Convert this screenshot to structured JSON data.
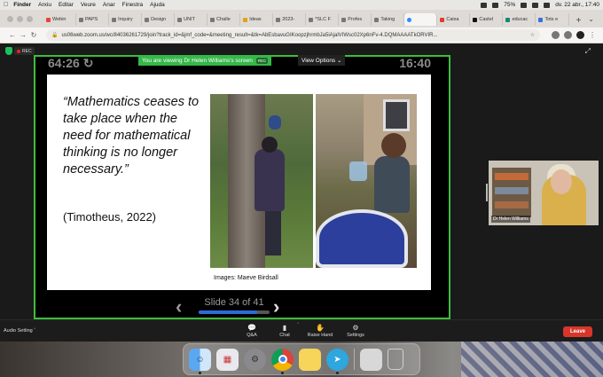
{
  "menubar": {
    "app": "Finder",
    "items": [
      "Arxiu",
      "Editar",
      "Veure",
      "Anar",
      "Finestra",
      "Ajuda"
    ],
    "battery": "75%",
    "datetime": "dv. 22 abr., 17:40"
  },
  "browser": {
    "tabs": [
      {
        "label": "Webin",
        "fav": "gmail"
      },
      {
        "label": "PAPS",
        "fav": "gray"
      },
      {
        "label": "Inquiry",
        "fav": "gray"
      },
      {
        "label": "Design",
        "fav": "gray"
      },
      {
        "label": "UNIT",
        "fav": "gray"
      },
      {
        "label": "Challe",
        "fav": "gray"
      },
      {
        "label": "Ideas",
        "fav": "gold"
      },
      {
        "label": "2023-",
        "fav": "gray"
      },
      {
        "label": "*SLC F",
        "fav": "gray"
      },
      {
        "label": "Profes",
        "fav": "gray"
      },
      {
        "label": "Taking",
        "fav": "gray"
      },
      {
        "label": "",
        "fav": "zoom"
      },
      {
        "label": "Caixa",
        "fav": "red"
      },
      {
        "label": "Castel",
        "fav": "amz"
      },
      {
        "label": "educac",
        "fav": "teal"
      },
      {
        "label": "Tots e",
        "fav": "blue"
      }
    ],
    "active_tab_index": 11,
    "url": "us06web.zoom.us/wc/84036261729/join?track_id=&jmf_code=&meeting_result=&tk=AbEsbavuGIKoopzjhrmbJa5iAjalVIWsc02Xp6nFv-4.DQMAAAATkORVIR..."
  },
  "zoom": {
    "rec_label": "REC",
    "timer_left": "64:26",
    "timer_right": "16:40",
    "viewing_text": "You are viewing Dr Helen Williams's screen",
    "viewing_rec": "REC",
    "view_options": "View Options",
    "slide": {
      "quote": "“Mathematics ceases to take place when the need for mathematical thinking is no longer necessary.”",
      "citation": "(Timotheus, 2022)",
      "credit": "Images: Maeve Birdsall"
    },
    "slide_counter": "Slide 34 of 41",
    "slide_current": 34,
    "slide_total": 41,
    "participant_name": "Dr Helen Williams",
    "toolbar": {
      "audio_setting": "Audio Setting",
      "qa": "Q&A",
      "chat": "Chat",
      "raise_hand": "Raise Hand",
      "settings": "Settings",
      "leave": "Leave"
    }
  },
  "dock": {
    "apps": [
      "finder",
      "launchpad",
      "system-preferences",
      "chrome",
      "notes",
      "telegram",
      "preview",
      "trash"
    ]
  }
}
